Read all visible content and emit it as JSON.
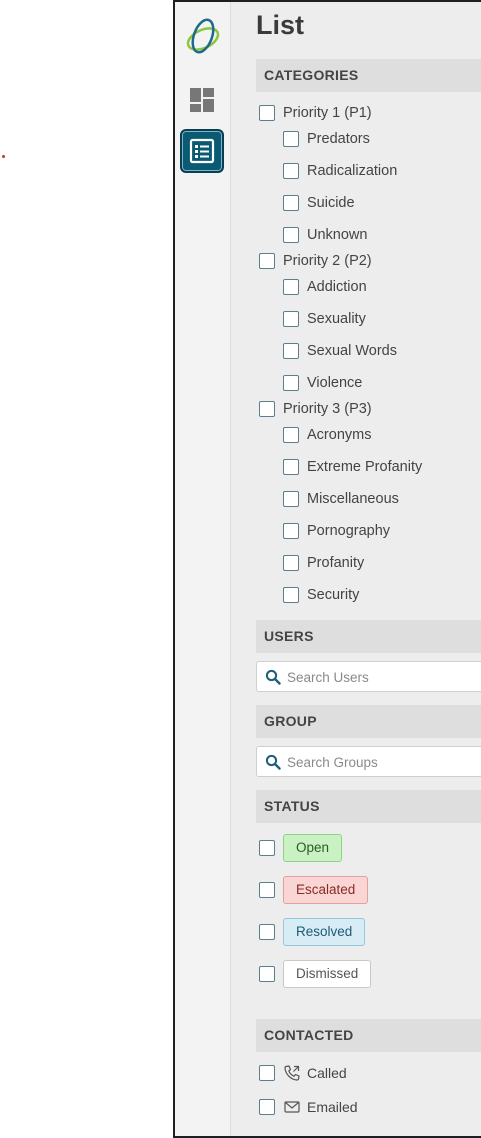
{
  "page": {
    "title": "List"
  },
  "rail": {
    "items": [
      {
        "name": "dashboard",
        "icon": "dashboard-icon"
      },
      {
        "name": "list",
        "icon": "list-icon",
        "active": true
      }
    ]
  },
  "sections": {
    "categories": "CATEGORIES",
    "users": "USERS",
    "group": "GROUP",
    "status": "STATUS",
    "contacted": "CONTACTED"
  },
  "categories": {
    "p1": {
      "label": "Priority 1 (P1)",
      "items": [
        "Predators",
        "Radicalization",
        "Suicide",
        "Unknown"
      ]
    },
    "p2": {
      "label": "Priority 2 (P2)",
      "items": [
        "Addiction",
        "Sexuality",
        "Sexual Words",
        "Violence"
      ]
    },
    "p3": {
      "label": "Priority 3 (P3)",
      "items": [
        "Acronyms",
        "Extreme Profanity",
        "Miscellaneous",
        "Pornography",
        "Profanity",
        "Security"
      ]
    }
  },
  "users_search": {
    "placeholder": "Search Users"
  },
  "group_search": {
    "placeholder": "Search Groups"
  },
  "status": {
    "items": [
      "Open",
      "Escalated",
      "Resolved",
      "Dismissed"
    ],
    "colors": {
      "open": "#c9f1c4",
      "escalated": "#f9d6d4",
      "resolved": "#d8ecf5",
      "dismissed": "#ffffff"
    }
  },
  "contacted": {
    "items": [
      {
        "label": "Called",
        "icon": "phone-icon"
      },
      {
        "label": "Emailed",
        "icon": "mail-icon"
      }
    ]
  },
  "colors": {
    "accent": "#0b5a74",
    "section_bg": "#dedede",
    "panel_bg": "#ededed"
  }
}
